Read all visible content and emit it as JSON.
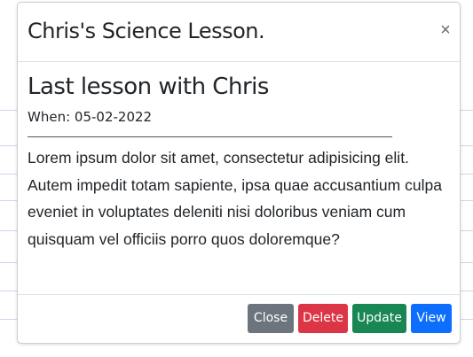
{
  "modal": {
    "title": "Chris's Science Lesson.",
    "close_symbol": "×",
    "close_icon": "close-icon"
  },
  "lesson": {
    "title": "Last lesson with Chris",
    "when": "When: 05-02-2022",
    "text": "Lorem ipsum dolor sit amet, consectetur adipisicing elit. Autem impedit totam sapiente, ipsa quae accusantium culpa eveniet in voluptates deleniti nisi doloribus veniam cum quisquam vel officiis porro quos doloremque?"
  },
  "footer": {
    "close_label": "Close",
    "delete_label": "Delete",
    "update_label": "Update",
    "view_label": "View"
  },
  "colors": {
    "close": "#6c757d",
    "delete": "#dc3545",
    "update": "#198754",
    "view": "#0d6efd"
  }
}
